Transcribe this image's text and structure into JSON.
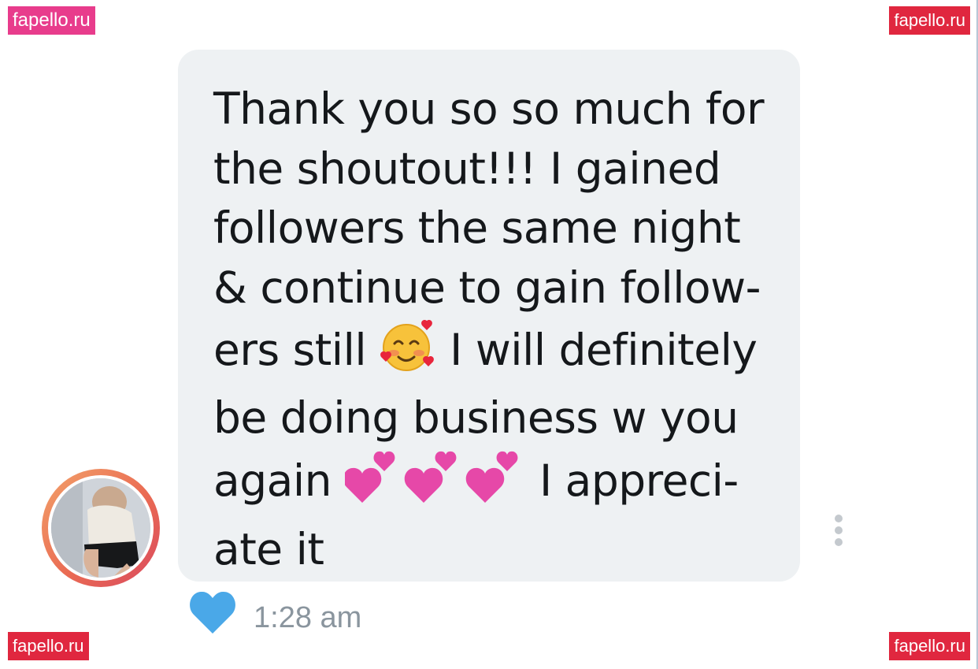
{
  "watermarks": {
    "top_left": "fapello.ru",
    "top_right": "fapello.ru",
    "bottom_left": "fapello.ru",
    "bottom_right": "fapello.ru"
  },
  "message": {
    "lines": [
      "Thank you so so much for",
      "the shoutout!!! I gained",
      "followers the same night",
      "& continue to gain follow-",
      "ers still",
      "I will definitely",
      "be doing business w you",
      "again",
      "I appreci-",
      "ate it"
    ],
    "emojis": {
      "smiling_face_with_hearts": "🥰",
      "two_hearts": "💕"
    },
    "liked": true,
    "timestamp": "1:28 am"
  },
  "icons": {
    "like": "heart-icon",
    "more": "more-vertical-icon",
    "avatar": "user-avatar"
  },
  "colors": {
    "bubble_background": "#eef1f3",
    "message_text": "#15181b",
    "timestamp_text": "#8a959e",
    "heart": "#4aa8e8",
    "avatar_ring": "#ea6b53",
    "watermark": "#e0273f"
  }
}
